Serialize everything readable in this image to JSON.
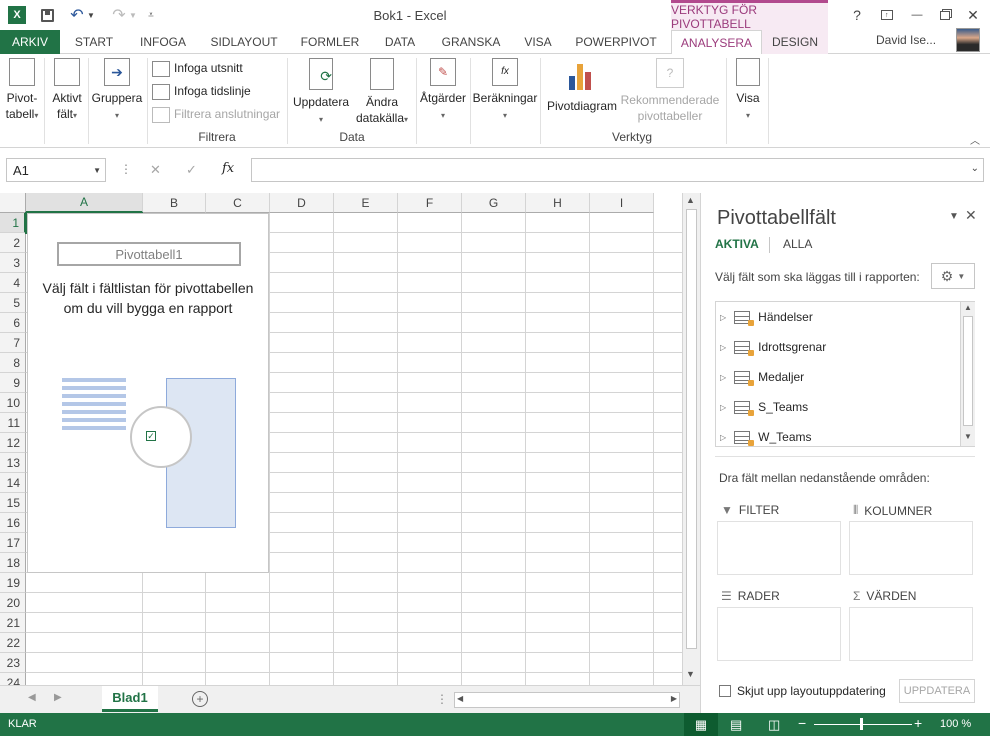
{
  "title_bar": {
    "doc_title": "Bok1 - Excel",
    "context_title": "VERKTYG FÖR PIVOTTABELL",
    "help": "?",
    "minimize": "—",
    "close": "✕"
  },
  "tabs": [
    "ARKIV",
    "START",
    "INFOGA",
    "SIDLAYOUT",
    "FORMLER",
    "DATA",
    "GRANSKA",
    "VISA",
    "POWERPIVOT",
    "ANALYSERA",
    "DESIGN"
  ],
  "user_name": "David Ise...",
  "ribbon": {
    "pivottabell": "Pivot-\ntabell",
    "aktivt_falt": "Aktivt\nfält",
    "gruppera": "Gruppera",
    "infoga_utsnitt": "Infoga utsnitt",
    "infoga_tidslinje": "Infoga tidslinje",
    "filtrera_anslutningar": "Filtrera anslutningar",
    "filtrera_group": "Filtrera",
    "uppdatera": "Uppdatera",
    "andra_datakalla": "Ändra\ndatakälla",
    "data_group": "Data",
    "atgarder": "Åtgärder",
    "berakningar": "Beräkningar",
    "pivotdiagram": "Pivotdiagram",
    "rekommenderade": "Rekommenderade\npivottabeller",
    "verktyg_group": "Verktyg",
    "visa": "Visa"
  },
  "formula_bar": {
    "name_box": "A1",
    "fx": "fx",
    "cancel": "✕",
    "enter": "✓"
  },
  "grid": {
    "columns": [
      "A",
      "B",
      "C",
      "D",
      "E",
      "F",
      "G",
      "H",
      "I"
    ],
    "rows": [
      "1",
      "2",
      "3",
      "4",
      "5",
      "6",
      "7",
      "8",
      "9",
      "10",
      "11",
      "12",
      "13",
      "14",
      "15",
      "16",
      "17",
      "18",
      "19",
      "20",
      "21",
      "22",
      "23",
      "24"
    ]
  },
  "pivot_placeholder": {
    "name": "Pivottabell1",
    "message": "Välj fält i fältlistan för pivottabellen om du vill bygga en rapport"
  },
  "sheet_tabs": {
    "active": "Blad1"
  },
  "pane": {
    "title": "Pivottabellfält",
    "tab_active": "AKTIVA",
    "tab_all": "ALLA",
    "choose_label": "Välj fält som ska läggas till i rapporten:",
    "fields": [
      "Händelser",
      "Idrottsgrenar",
      "Medaljer",
      "S_Teams",
      "W_Teams"
    ],
    "drag_label": "Dra fält mellan nedanstående områden:",
    "filter": "FILTER",
    "columns": "KOLUMNER",
    "rows": "RADER",
    "values": "VÄRDEN",
    "defer_label": "Skjut upp layoutuppdatering",
    "update_button": "UPPDATERA"
  },
  "status": {
    "ready": "KLAR",
    "zoom": "100 %"
  },
  "colors": {
    "excel_green": "#217346",
    "context_magenta": "#9b3b7c"
  }
}
